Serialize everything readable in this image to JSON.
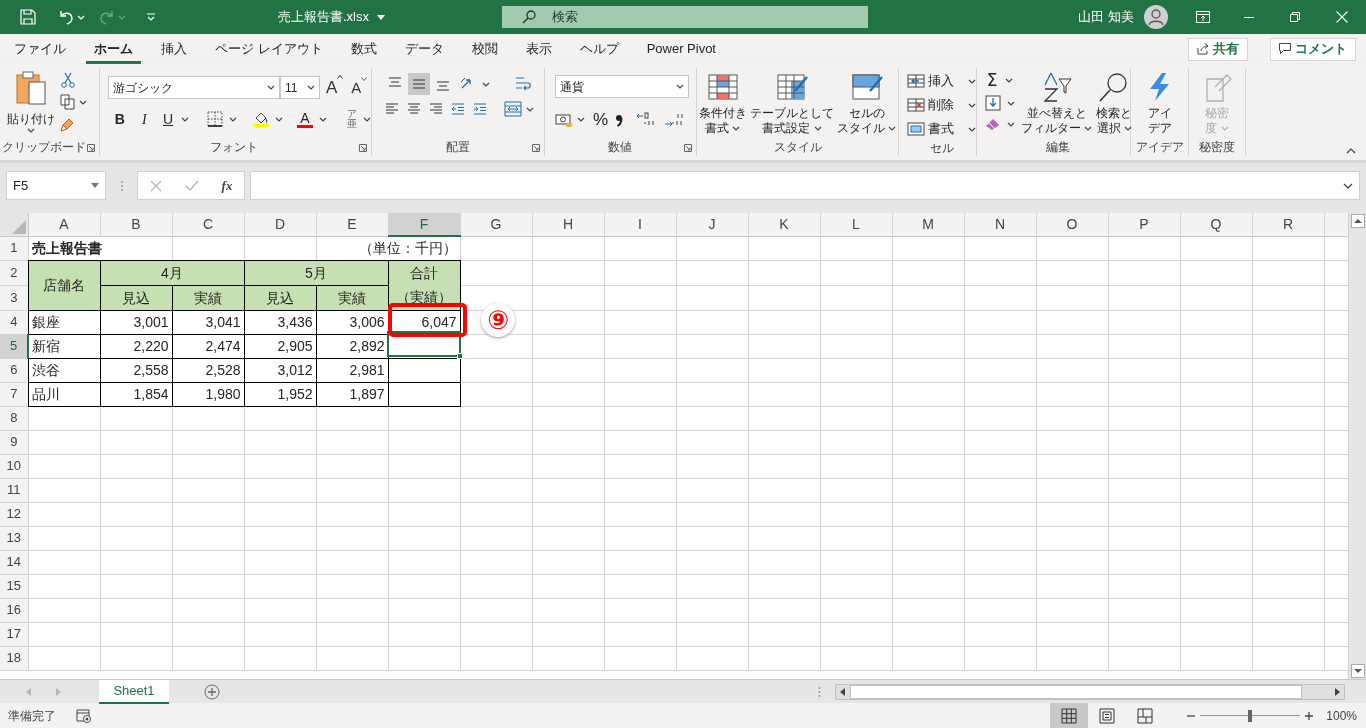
{
  "title_bar": {
    "file_name": "売上報告書.xlsx",
    "search": {
      "placeholder": "検索"
    },
    "user_name": "山田 知美"
  },
  "menu_tabs": [
    {
      "label": "ファイル",
      "selected": false
    },
    {
      "label": "ホーム",
      "selected": true
    },
    {
      "label": "挿入",
      "selected": false
    },
    {
      "label": "ページ レイアウト",
      "selected": false
    },
    {
      "label": "数式",
      "selected": false
    },
    {
      "label": "データ",
      "selected": false
    },
    {
      "label": "校閲",
      "selected": false
    },
    {
      "label": "表示",
      "selected": false
    },
    {
      "label": "ヘルプ",
      "selected": false
    },
    {
      "label": "Power Pivot",
      "selected": false
    }
  ],
  "share_button": "共有",
  "comment_button": "コメント",
  "ribbon": {
    "clipboard": {
      "label": "クリップボード",
      "paste": "貼り付け"
    },
    "font": {
      "label": "フォント",
      "font_name": "游ゴシック",
      "font_size": "11",
      "grow": "A",
      "shrink": "A",
      "bold": "B",
      "italic": "I",
      "underline": "U",
      "font_color": "A",
      "phonetic": [
        "ア",
        "亜"
      ]
    },
    "alignment": {
      "label": "配置",
      "vertical": [
        {
          "selected": false
        },
        {
          "selected": true
        },
        {
          "selected": false
        }
      ]
    },
    "number": {
      "label": "数値",
      "format": "通貨",
      "percent": "%"
    },
    "styles": {
      "label": "スタイル",
      "buttons": [
        [
          "条件付き",
          "書式"
        ],
        [
          "テーブルとして",
          "書式設定"
        ],
        [
          "セルの",
          "スタイル"
        ]
      ]
    },
    "cells": {
      "label": "セル",
      "buttons": [
        "挿入",
        "削除",
        "書式"
      ]
    },
    "editing": {
      "label": "編集",
      "sum": "Σ",
      "buttons": [
        [
          "並べ替えと",
          "フィルター"
        ],
        [
          "検索と",
          "選択"
        ]
      ]
    },
    "ideas": {
      "label": "アイデア",
      "button": [
        "アイ",
        "デア"
      ]
    },
    "sensitivity": {
      "label": "秘密度",
      "button": [
        "秘密",
        "度"
      ],
      "disabled": true
    }
  },
  "formula_bar": {
    "name_box": "F5",
    "function_button": "fx"
  },
  "sheet": {
    "columns": [
      {
        "label": "A",
        "selected": false
      },
      {
        "label": "B",
        "selected": false
      },
      {
        "label": "C",
        "selected": false
      },
      {
        "label": "D",
        "selected": false
      },
      {
        "label": "E",
        "selected": false
      },
      {
        "label": "F",
        "selected": true
      },
      {
        "label": "G",
        "selected": false
      },
      {
        "label": "H",
        "selected": false
      },
      {
        "label": "I",
        "selected": false
      },
      {
        "label": "J",
        "selected": false
      },
      {
        "label": "K",
        "selected": false
      },
      {
        "label": "L",
        "selected": false
      },
      {
        "label": "M",
        "selected": false
      },
      {
        "label": "N",
        "selected": false
      },
      {
        "label": "O",
        "selected": false
      },
      {
        "label": "P",
        "selected": false
      },
      {
        "label": "Q",
        "selected": false
      },
      {
        "label": "R",
        "selected": false
      }
    ],
    "rows": [
      {
        "label": "1",
        "selected": false,
        "cells": [
          {
            "text": "売上報告書",
            "kind": "title",
            "merged_right": true
          },
          {
            "kind": "empty"
          },
          {
            "kind": "empty"
          },
          {
            "text": "（単位：千円）",
            "kind": "unit",
            "merged_right": true
          }
        ]
      },
      {
        "label": "2",
        "selected": false,
        "cells": [
          {
            "text": "店舗名",
            "kind": "header",
            "merged_down": true
          },
          {
            "text": "4月",
            "kind": "header",
            "merged_right": true
          },
          {
            "text": "5月",
            "kind": "header",
            "merged_right": true
          },
          {
            "lines": [
              "合計",
              "（実績）"
            ],
            "kind": "header",
            "merged_down": true
          }
        ]
      },
      {
        "label": "3",
        "selected": false,
        "cells": [
          {
            "text": "見込",
            "kind": "header"
          },
          {
            "text": "実績",
            "kind": "header"
          },
          {
            "text": "見込",
            "kind": "header"
          },
          {
            "text": "実績",
            "kind": "header"
          }
        ]
      },
      {
        "label": "4",
        "selected": false,
        "cells": [
          {
            "text": "銀座",
            "kind": "label"
          },
          {
            "text": "3,001",
            "kind": "number"
          },
          {
            "text": "3,041",
            "kind": "number"
          },
          {
            "text": "3,436",
            "kind": "number"
          },
          {
            "text": "3,006",
            "kind": "number"
          },
          {
            "text": "6,047",
            "kind": "number"
          }
        ]
      },
      {
        "label": "5",
        "selected": true,
        "cells": [
          {
            "text": "新宿",
            "kind": "label"
          },
          {
            "text": "2,220",
            "kind": "number"
          },
          {
            "text": "2,474",
            "kind": "number"
          },
          {
            "text": "2,905",
            "kind": "number"
          },
          {
            "text": "2,892",
            "kind": "number"
          },
          {
            "kind": "blank"
          }
        ]
      },
      {
        "label": "6",
        "selected": false,
        "cells": [
          {
            "text": "渋谷",
            "kind": "label"
          },
          {
            "text": "2,558",
            "kind": "number"
          },
          {
            "text": "2,528",
            "kind": "number"
          },
          {
            "text": "3,012",
            "kind": "number"
          },
          {
            "text": "2,981",
            "kind": "number"
          },
          {
            "kind": "blank"
          }
        ]
      },
      {
        "label": "7",
        "selected": false,
        "cells": [
          {
            "text": "品川",
            "kind": "label"
          },
          {
            "text": "1,854",
            "kind": "number"
          },
          {
            "text": "1,980",
            "kind": "number"
          },
          {
            "text": "1,952",
            "kind": "number"
          },
          {
            "text": "1,897",
            "kind": "number"
          },
          {
            "kind": "blank"
          }
        ]
      },
      {
        "label": "8",
        "selected": false
      },
      {
        "label": "9",
        "selected": false
      },
      {
        "label": "10",
        "selected": false
      },
      {
        "label": "11",
        "selected": false
      },
      {
        "label": "12",
        "selected": false
      },
      {
        "label": "13",
        "selected": false
      },
      {
        "label": "14",
        "selected": false
      },
      {
        "label": "15",
        "selected": false
      },
      {
        "label": "16",
        "selected": false
      },
      {
        "label": "17",
        "selected": false
      },
      {
        "label": "18",
        "selected": false
      }
    ]
  },
  "callout": {
    "label": "⑨",
    "frame": true
  },
  "sheet_tabs": [
    {
      "label": "Sheet1",
      "selected": true
    }
  ],
  "status_bar": {
    "status": "準備完了",
    "views": [
      {
        "selected": true
      },
      {
        "selected": false
      },
      {
        "selected": false
      }
    ],
    "zoom": {
      "level": 0.5,
      "reading": "100%"
    }
  }
}
